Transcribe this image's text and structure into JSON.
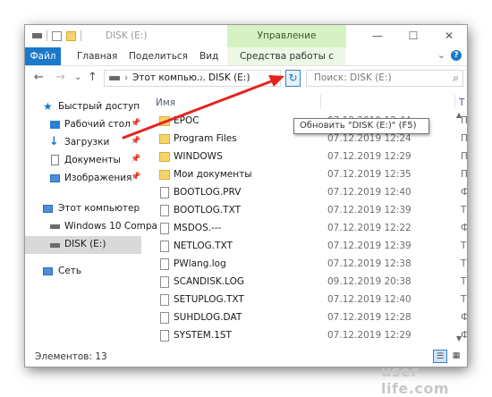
{
  "window": {
    "title": "DISK (E:)",
    "context_tab_title": "Управление",
    "buttons": [
      "—",
      "☐",
      "✕"
    ]
  },
  "ribbon": {
    "tabs": [
      "Файл",
      "Главная",
      "Поделиться",
      "Вид",
      "Средства работы с дисками"
    ],
    "help": "?"
  },
  "nav": {
    "back": "←",
    "forward": "→",
    "recent": "⌄",
    "up": "↑",
    "breadcrumb": [
      "Этот компью...",
      "DISK (E:)"
    ],
    "refresh_glyph": "↻",
    "search_placeholder": "Поиск: DISK (E:)"
  },
  "tooltip": "Обновить \"DISK (E:)\" (F5)",
  "sidebar": {
    "items": [
      {
        "label": "Быстрый доступ",
        "icon": "star-icon"
      },
      {
        "label": "Рабочий стол",
        "icon": "desktop-icon",
        "pinned": true
      },
      {
        "label": "Загрузки",
        "icon": "download-icon",
        "pinned": true
      },
      {
        "label": "Документы",
        "icon": "documents-icon",
        "pinned": true
      },
      {
        "label": "Изображения",
        "icon": "images-icon",
        "pinned": true
      },
      {
        "label": "Этот компьютер",
        "icon": "computer-icon"
      },
      {
        "label": "Windows 10 Compa",
        "icon": "drive-icon"
      },
      {
        "label": "DISK (E:)",
        "icon": "drive-icon",
        "selected": true
      },
      {
        "label": "Сеть",
        "icon": "network-icon"
      }
    ]
  },
  "columns": {
    "name": "Имя",
    "date": "",
    "type": "Т"
  },
  "files": [
    {
      "name": "EPOC",
      "date": "07.12.2019 12:44",
      "type": "П",
      "kind": "folder"
    },
    {
      "name": "Program Files",
      "date": "07.12.2019 12:24",
      "type": "П",
      "kind": "folder"
    },
    {
      "name": "WINDOWS",
      "date": "07.12.2019 12:29",
      "type": "П",
      "kind": "folder"
    },
    {
      "name": "Мои документы",
      "date": "07.12.2019 12:35",
      "type": "П",
      "kind": "folder"
    },
    {
      "name": "BOOTLOG.PRV",
      "date": "07.12.2019 12:40",
      "type": "Ф",
      "kind": "file"
    },
    {
      "name": "BOOTLOG.TXT",
      "date": "07.12.2019 12:39",
      "type": "Те",
      "kind": "file"
    },
    {
      "name": "MSDOS.---",
      "date": "07.12.2019 12:22",
      "type": "Ф",
      "kind": "file"
    },
    {
      "name": "NETLOG.TXT",
      "date": "07.12.2019 12:39",
      "type": "Те",
      "kind": "file"
    },
    {
      "name": "PWlang.log",
      "date": "07.12.2019 12:38",
      "type": "Те",
      "kind": "file"
    },
    {
      "name": "SCANDISK.LOG",
      "date": "09.12.2019 20:38",
      "type": "Те",
      "kind": "file"
    },
    {
      "name": "SETUPLOG.TXT",
      "date": "07.12.2019 12:40",
      "type": "Те",
      "kind": "file"
    },
    {
      "name": "SUHDLOG.DAT",
      "date": "07.12.2019 12:28",
      "type": "Ф",
      "kind": "file"
    },
    {
      "name": "SYSTEM.1ST",
      "date": "07.12.2019 12:29",
      "type": "Ф",
      "kind": "file"
    }
  ],
  "status": {
    "items_count": "Элементов: 13"
  },
  "watermark": "user-life.com",
  "colors": {
    "accent": "#1979ca",
    "context_tab": "#d6f2c4",
    "arrow": "#e5231e",
    "folder": "#f6d36b"
  }
}
